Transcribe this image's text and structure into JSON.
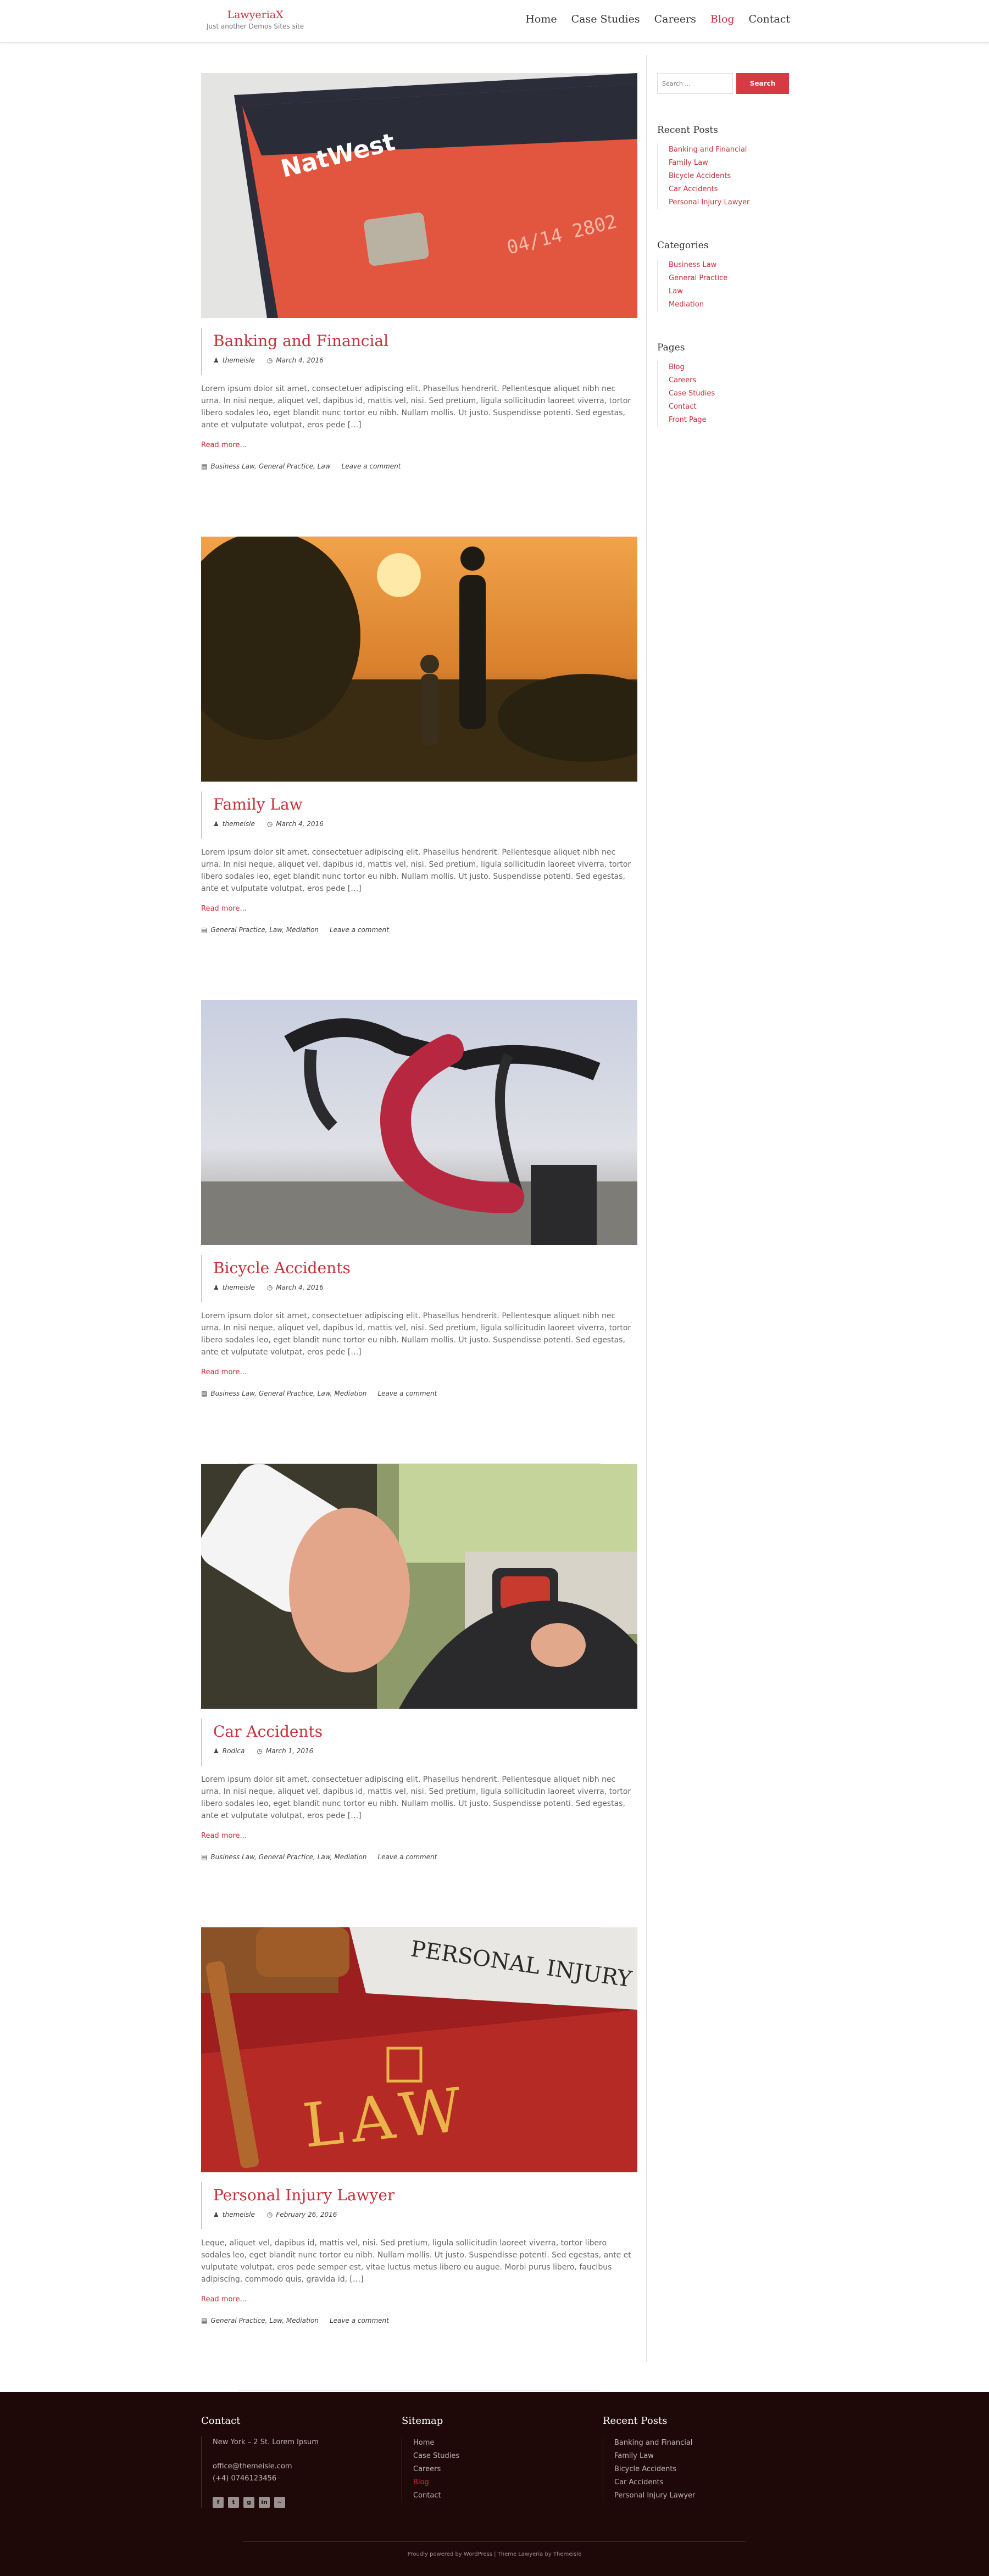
{
  "header": {
    "site_title": "LawyeriaX",
    "tagline": "Just another Demos Sites site",
    "nav": [
      {
        "label": "Home",
        "active": false
      },
      {
        "label": "Case Studies",
        "active": false
      },
      {
        "label": "Careers",
        "active": false
      },
      {
        "label": "Blog",
        "active": true
      },
      {
        "label": "Contact",
        "active": false
      }
    ]
  },
  "posts": [
    {
      "title": "Banking and Financial",
      "author": "themeisle",
      "date": "March 4, 2016",
      "image": "credit-card-photo",
      "excerpt": "Lorem ipsum dolor sit amet, consectetuer adipiscing elit. Phasellus hendrerit. Pellentesque aliquet nibh nec urna. In nisi neque, aliquet vel, dapibus id, mattis vel, nisi. Sed pretium, ligula sollicitudin laoreet viverra, tortor libero sodales leo, eget blandit nunc tortor eu nibh. Nullam mollis. Ut justo. Suspendisse potenti. Sed egestas, ante et vulputate volutpat, eros pede […]",
      "read_more": "Read more...",
      "categories": "Business Law, General Practice, Law",
      "comment": "Leave a comment"
    },
    {
      "title": "Family Law",
      "author": "themeisle",
      "date": "March 4, 2016",
      "image": "father-child-sunset-photo",
      "excerpt": "Lorem ipsum dolor sit amet, consectetuer adipiscing elit. Phasellus hendrerit. Pellentesque aliquet nibh nec urna. In nisi neque, aliquet vel, dapibus id, mattis vel, nisi. Sed pretium, ligula sollicitudin laoreet viverra, tortor libero sodales leo, eget blandit nunc tortor eu nibh. Nullam mollis. Ut justo. Suspendisse potenti. Sed egestas, ante et vulputate volutpat, eros pede […]",
      "read_more": "Read more...",
      "categories": "General Practice, Law, Mediation",
      "comment": "Leave a comment"
    },
    {
      "title": "Bicycle Accidents",
      "author": "themeisle",
      "date": "March 4, 2016",
      "image": "bicycle-handlebar-photo",
      "excerpt": "Lorem ipsum dolor sit amet, consectetuer adipiscing elit. Phasellus hendrerit. Pellentesque aliquet nibh nec urna. In nisi neque, aliquet vel, dapibus id, mattis vel, nisi. Sed pretium, ligula sollicitudin laoreet viverra, tortor libero sodales leo, eget blandit nunc tortor eu nibh. Nullam mollis. Ut justo. Suspendisse potenti. Sed egestas, ante et vulputate volutpat, eros pede […]",
      "read_more": "Read more...",
      "categories": "Business Law, General Practice, Law, Mediation",
      "comment": "Leave a comment"
    },
    {
      "title": "Car Accidents",
      "author": "Rodica",
      "date": "March 1, 2016",
      "image": "woman-phone-car-photo",
      "excerpt": "Lorem ipsum dolor sit amet, consectetuer adipiscing elit. Phasellus hendrerit. Pellentesque aliquet nibh nec urna. In nisi neque, aliquet vel, dapibus id, mattis vel, nisi. Sed pretium, ligula sollicitudin laoreet viverra, tortor libero sodales leo, eget blandit nunc tortor eu nibh. Nullam mollis. Ut justo. Suspendisse potenti. Sed egestas, ante et vulputate volutpat, eros pede […]",
      "read_more": "Read more...",
      "categories": "Business Law, General Practice, Law, Mediation",
      "comment": "Leave a comment"
    },
    {
      "title": "Personal Injury Lawyer",
      "author": "themeisle",
      "date": "February 26, 2016",
      "image": "personal-injury-law-book-photo",
      "excerpt": "Leque, aliquet vel, dapibus id, mattis vel, nisi. Sed pretium, ligula sollicitudin laoreet viverra, tortor libero sodales leo, eget blandit nunc tortor eu nibh. Nullam mollis. Ut justo. Suspendisse potenti. Sed egestas, ante et vulputate volutpat, eros pede semper est, vitae luctus metus libero eu augue. Morbi purus libero, faucibus adipiscing, commodo quis, gravida id, […]",
      "read_more": "Read more...",
      "categories": "General Practice, Law, Mediation",
      "comment": "Leave a comment"
    }
  ],
  "sidebar": {
    "search_placeholder": "Search ...",
    "search_button": "Search",
    "recent_posts_title": "Recent Posts",
    "recent_posts": [
      "Banking and Financial",
      "Family Law",
      "Bicycle Accidents",
      "Car Accidents",
      "Personal Injury Lawyer"
    ],
    "categories_title": "Categories",
    "categories": [
      "Business Law",
      "General Practice",
      "Law",
      "Mediation"
    ],
    "pages_title": "Pages",
    "pages": [
      "Blog",
      "Careers",
      "Case Studies",
      "Contact",
      "Front Page"
    ]
  },
  "footer": {
    "contact_title": "Contact",
    "address": "New York – 2 St. Lorem Ipsum",
    "email": "office@themeisle.com",
    "phone": "(+4) 0746123456",
    "social": [
      "facebook-icon",
      "twitter-icon",
      "googleplus-icon",
      "linkedin-icon",
      "rss-icon"
    ],
    "sitemap_title": "Sitemap",
    "sitemap": [
      {
        "label": "Home",
        "active": false
      },
      {
        "label": "Case Studies",
        "active": false
      },
      {
        "label": "Careers",
        "active": false
      },
      {
        "label": "Blog",
        "active": true
      },
      {
        "label": "Contact",
        "active": false
      }
    ],
    "recent_title": "Recent Posts",
    "recent": [
      "Banking and Financial",
      "Family Law",
      "Bicycle Accidents",
      "Car Accidents",
      "Personal Injury Lawyer"
    ],
    "credit": "Proudly powered by WordPress | Theme Lawyeria by Themeisle"
  },
  "colors": {
    "accent": "#c8303b",
    "footer_bg": "#1f0808"
  }
}
